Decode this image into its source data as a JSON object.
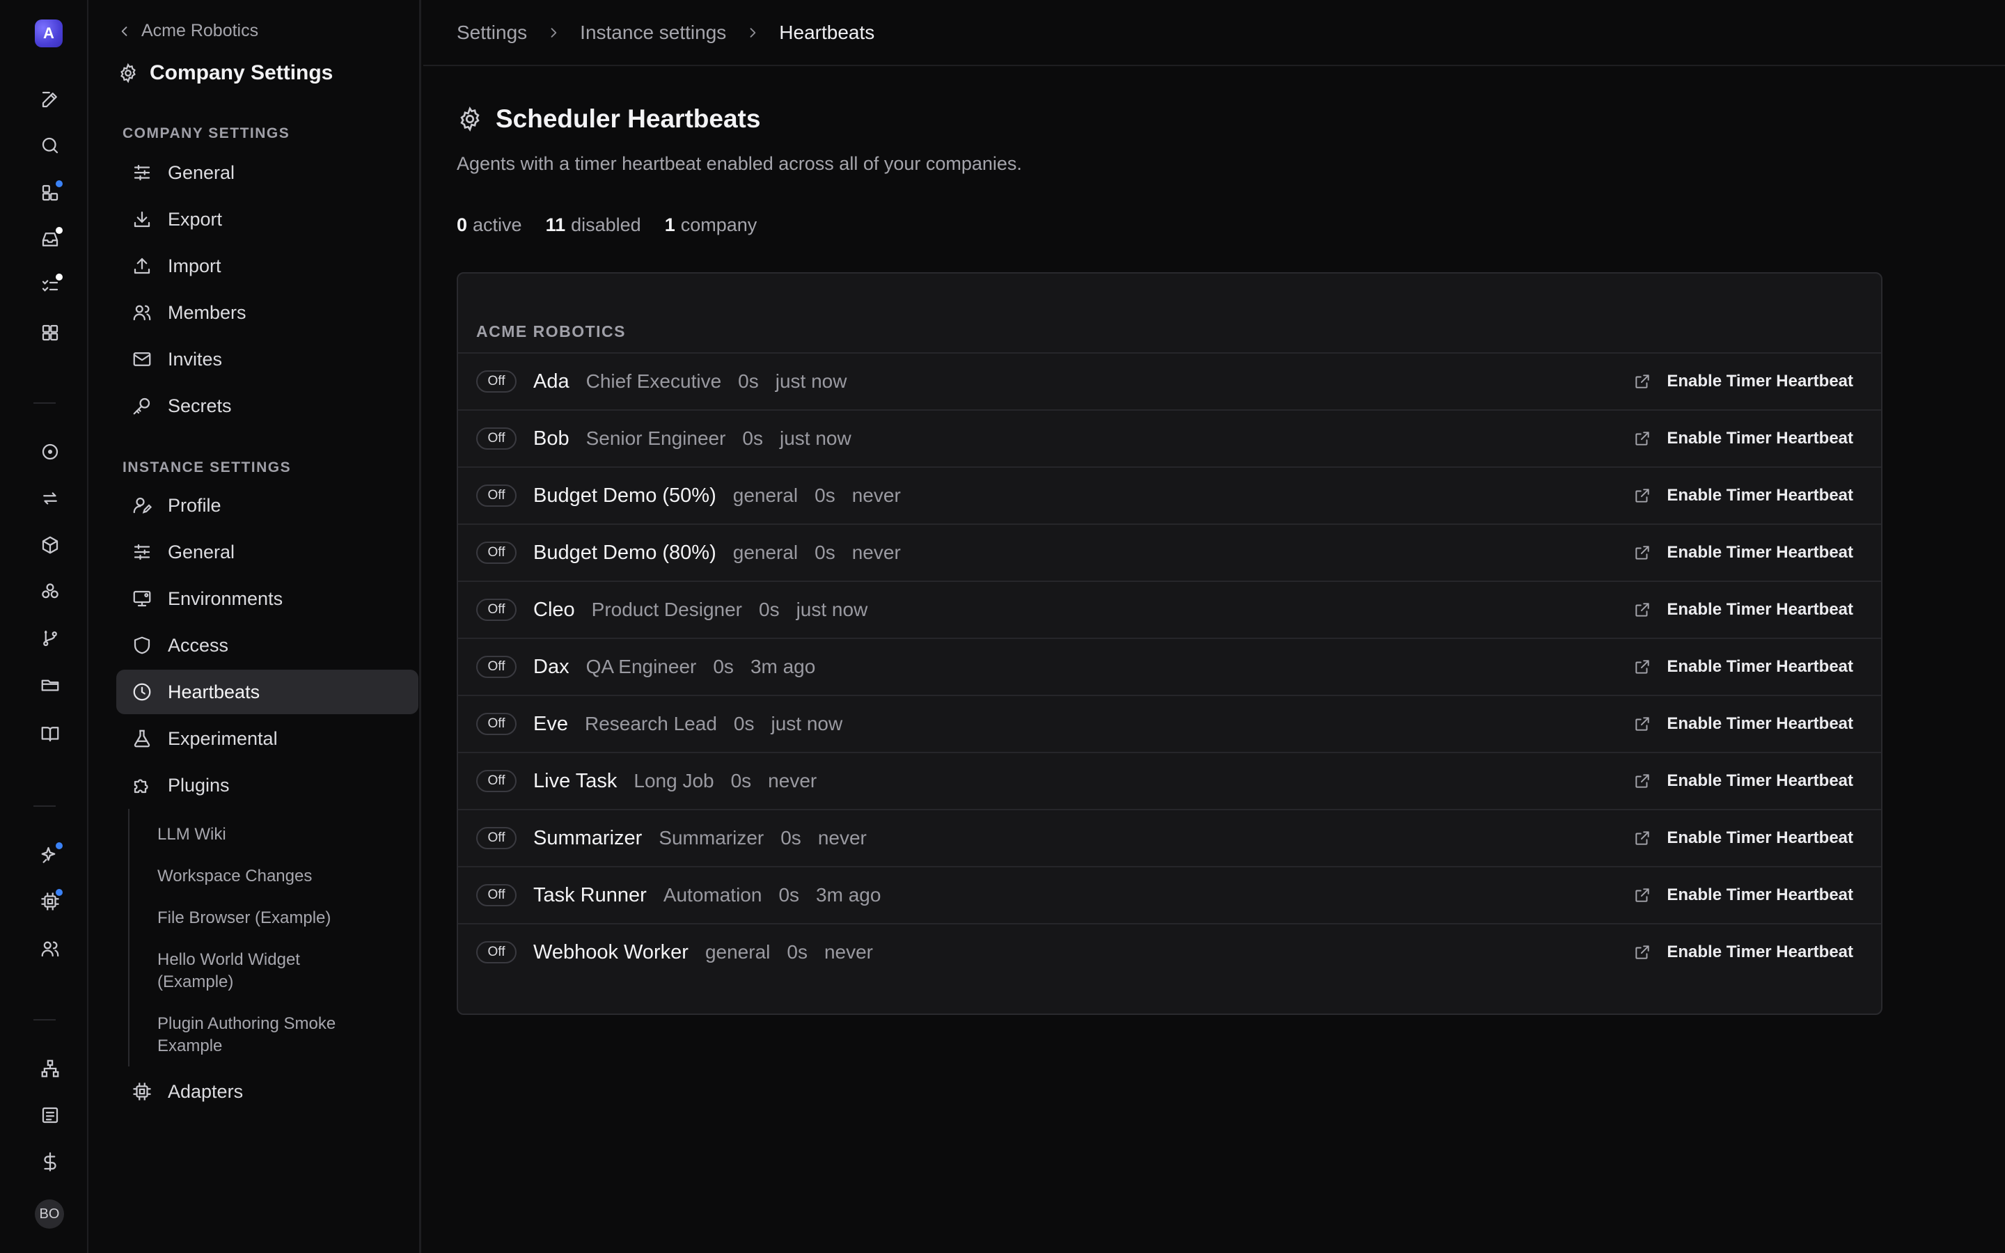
{
  "rail": {
    "logo_letter": "A",
    "avatar_initials": "BO",
    "icons": [
      "edit-icon",
      "search-icon",
      "dashboard-icon",
      "inbox-icon",
      "tasks-icon",
      "apps-icon",
      "circle-dot-icon",
      "transfer-icon",
      "package-icon",
      "components-icon",
      "branch-icon",
      "folder-icon",
      "book-icon",
      "sparkle-icon",
      "chip-icon",
      "users-icon",
      "org-chart-icon",
      "document-icon",
      "dollar-icon"
    ],
    "colors": {
      "dot_blue": "#3b82f6",
      "dot_white": "#ffffff"
    }
  },
  "sidebar": {
    "back_label": "Acme Robotics",
    "title": "Company Settings",
    "company_section": "COMPANY SETTINGS",
    "company_items": [
      "General",
      "Export",
      "Import",
      "Members",
      "Invites",
      "Secrets"
    ],
    "instance_section": "INSTANCE SETTINGS",
    "instance_items": [
      "Profile",
      "General",
      "Environments",
      "Access",
      "Heartbeats",
      "Experimental",
      "Plugins"
    ],
    "plugins": [
      "LLM Wiki",
      "Workspace Changes",
      "File Browser (Example)",
      "Hello World Widget (Example)",
      "Plugin Authoring Smoke Example"
    ],
    "adapters": "Adapters",
    "active_item": "Heartbeats"
  },
  "breadcrumb": [
    "Settings",
    "Instance settings",
    "Heartbeats"
  ],
  "page": {
    "title": "Scheduler Heartbeats",
    "description": "Agents with a timer heartbeat enabled across all of your companies.",
    "stats": {
      "active_count": "0",
      "active_label": "active",
      "disabled_count": "11",
      "disabled_label": "disabled",
      "company_count": "1",
      "company_label": "company"
    },
    "group": "ACME ROBOTICS",
    "status_label": "Off",
    "action_label": "Enable Timer Heartbeat",
    "agents": [
      {
        "name": "Ada",
        "role": "Chief Executive",
        "interval": "0s",
        "last": "just now"
      },
      {
        "name": "Bob",
        "role": "Senior Engineer",
        "interval": "0s",
        "last": "just now"
      },
      {
        "name": "Budget Demo (50%)",
        "role": "general",
        "interval": "0s",
        "last": "never"
      },
      {
        "name": "Budget Demo (80%)",
        "role": "general",
        "interval": "0s",
        "last": "never"
      },
      {
        "name": "Cleo",
        "role": "Product Designer",
        "interval": "0s",
        "last": "just now"
      },
      {
        "name": "Dax",
        "role": "QA Engineer",
        "interval": "0s",
        "last": "3m ago"
      },
      {
        "name": "Eve",
        "role": "Research Lead",
        "interval": "0s",
        "last": "just now"
      },
      {
        "name": "Live Task",
        "role": "Long Job",
        "interval": "0s",
        "last": "never"
      },
      {
        "name": "Summarizer",
        "role": "Summarizer",
        "interval": "0s",
        "last": "never"
      },
      {
        "name": "Task Runner",
        "role": "Automation",
        "interval": "0s",
        "last": "3m ago"
      },
      {
        "name": "Webhook Worker",
        "role": "general",
        "interval": "0s",
        "last": "never"
      }
    ]
  }
}
